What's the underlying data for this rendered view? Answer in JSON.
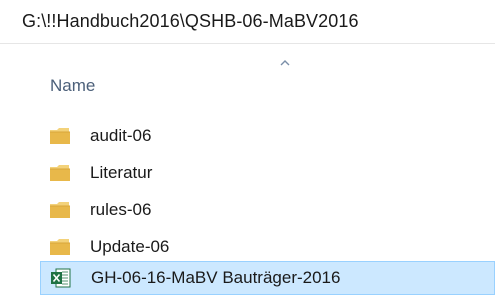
{
  "address_bar": {
    "path": "G:\\!!Handbuch2016\\QSHB-06-MaBV2016"
  },
  "columns": {
    "name_label": "Name",
    "sort_icon": "chevron-up-icon"
  },
  "items": [
    {
      "label": "audit-06",
      "type": "folder",
      "icon": "folder-icon"
    },
    {
      "label": "Literatur",
      "type": "folder",
      "icon": "folder-icon"
    },
    {
      "label": "rules-06",
      "type": "folder",
      "icon": "folder-icon"
    },
    {
      "label": "Update-06",
      "type": "folder",
      "icon": "folder-icon"
    },
    {
      "label": "GH-06-16-MaBV Bauträger-2016",
      "type": "excel-file",
      "icon": "excel-file-icon",
      "selected": true
    }
  ],
  "colors": {
    "folder": "#e8b84a",
    "excel": "#1f7244",
    "selection_bg": "#cce8ff",
    "selection_border": "#99d1ff",
    "header_text": "#4c607a"
  }
}
